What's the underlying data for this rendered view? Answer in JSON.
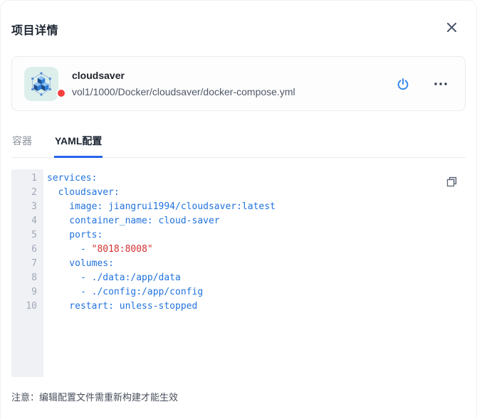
{
  "colors": {
    "accent_blue": "#2f86e8",
    "tab_underline": "#2563eb",
    "code_blue": "#2273dd",
    "code_red": "#d43030",
    "status_red": "#f53f3f"
  },
  "modal": {
    "title": "项目详情"
  },
  "project_card": {
    "name": "cloudsaver",
    "path": "vol1/1000/Docker/cloudsaver/docker-compose.yml",
    "status": "stopped"
  },
  "tabs": [
    {
      "id": "containers",
      "label": "容器",
      "active": false
    },
    {
      "id": "yaml",
      "label": "YAML配置",
      "active": true
    }
  ],
  "yaml_editor": {
    "lines": [
      {
        "num": "1",
        "segments": [
          {
            "text": "services:",
            "type": "code"
          }
        ]
      },
      {
        "num": "2",
        "segments": [
          {
            "text": "  cloudsaver:",
            "type": "code"
          }
        ]
      },
      {
        "num": "3",
        "segments": [
          {
            "text": "    image: jiangrui1994/cloudsaver:latest",
            "type": "code"
          }
        ]
      },
      {
        "num": "4",
        "segments": [
          {
            "text": "    container_name: cloud-saver",
            "type": "code"
          }
        ]
      },
      {
        "num": "5",
        "segments": [
          {
            "text": "    ports:",
            "type": "code"
          }
        ]
      },
      {
        "num": "6",
        "segments": [
          {
            "text": "      - ",
            "type": "code"
          },
          {
            "text": "\"8018:8008\"",
            "type": "string"
          }
        ]
      },
      {
        "num": "7",
        "segments": [
          {
            "text": "    volumes:",
            "type": "code"
          }
        ]
      },
      {
        "num": "8",
        "segments": [
          {
            "text": "      - ./data:/app/data",
            "type": "code"
          }
        ]
      },
      {
        "num": "9",
        "segments": [
          {
            "text": "      - ./config:/app/config",
            "type": "code"
          }
        ]
      },
      {
        "num": "10",
        "segments": [
          {
            "text": "    restart: unless-stopped",
            "type": "code"
          }
        ]
      }
    ]
  },
  "note": "注意：编辑配置文件需重新构建才能生效"
}
